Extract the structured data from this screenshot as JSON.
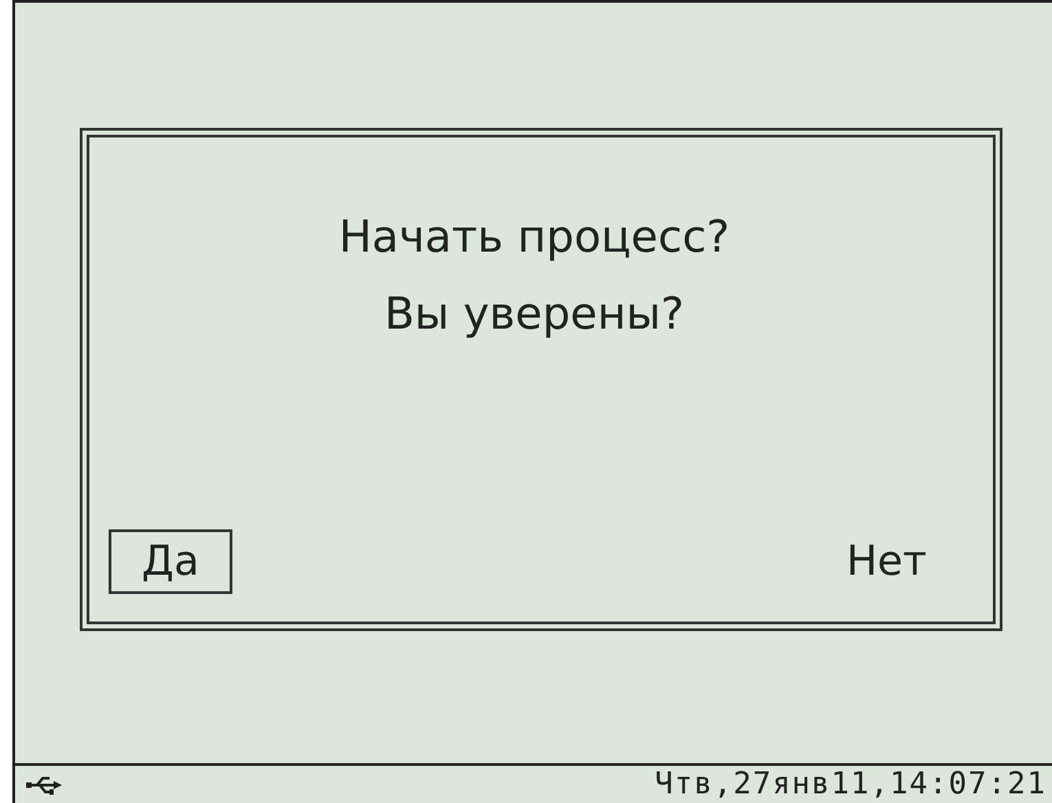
{
  "dialog": {
    "lines": [
      "Начать процесс?",
      "Вы уверены?"
    ],
    "buttons": [
      {
        "label": "Да",
        "selected": true
      },
      {
        "label": "Нет",
        "selected": false
      }
    ]
  },
  "status_bar": {
    "datetime": "Чтв,27янв11,14:07:21"
  }
}
